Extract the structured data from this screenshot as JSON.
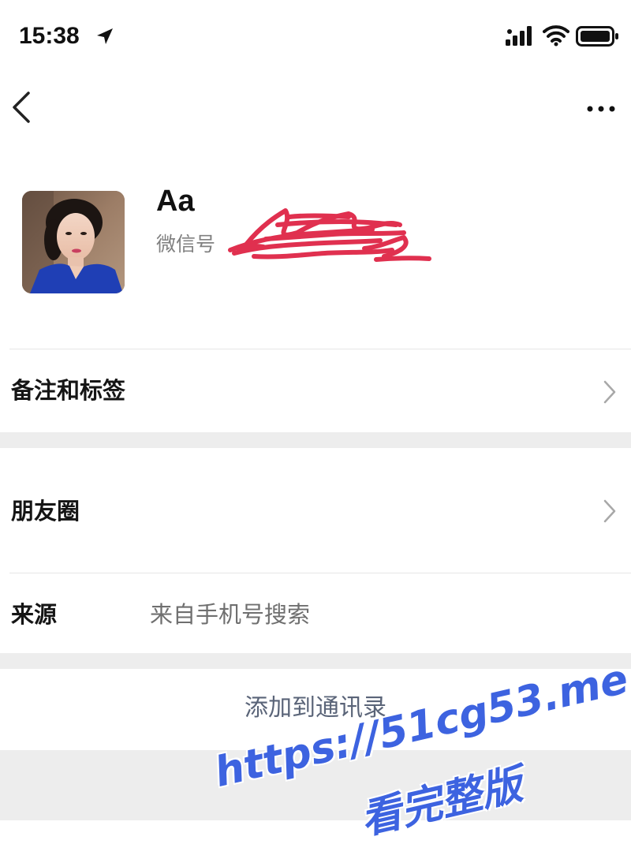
{
  "status_bar": {
    "time": "15:38"
  },
  "profile": {
    "name": "Aa",
    "wechat_id_label": "微信号"
  },
  "rows": {
    "remarks_tags": "备注和标签",
    "moments": "朋友圈",
    "source_label": "来源",
    "source_value": "来自手机号搜索"
  },
  "actions": {
    "add_to_contacts": "添加到通讯录"
  },
  "watermark": {
    "url": "https://51cg53.me",
    "subtitle": "看完整版"
  },
  "colors": {
    "background": "#ffffff",
    "section_gap": "#ededed",
    "secondary_text": "#808080",
    "link_text": "#5a6478",
    "redaction": "#e0304f",
    "watermark": "#3d63e0"
  },
  "icons": {
    "back": "chevron-left-icon",
    "more": "more-dots-icon",
    "row_arrow": "chevron-right-icon",
    "location": "location-arrow-icon",
    "signal": "cellular-signal-icon",
    "wifi": "wifi-icon",
    "battery": "battery-icon"
  }
}
